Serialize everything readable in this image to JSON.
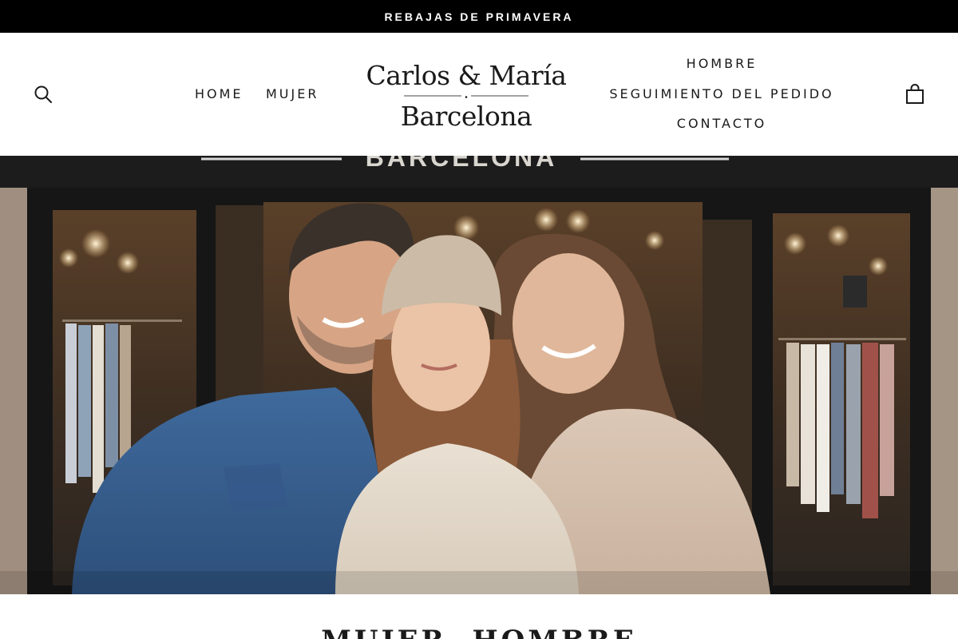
{
  "announcement": {
    "text": "REBAJAS DE PRIMAVERA"
  },
  "header": {
    "search_icon": "search-icon",
    "cart_icon": "shopping-bag-icon",
    "nav_left": [
      {
        "label": "HOME"
      },
      {
        "label": "MUJER"
      }
    ],
    "nav_right": [
      {
        "label": "HOMBRE"
      },
      {
        "label": "SEGUIMIENTO DEL PEDIDO"
      },
      {
        "label": "CONTACTO"
      }
    ],
    "logo": {
      "line1": "Carlos & María",
      "line2": "Barcelona"
    }
  },
  "hero": {
    "storefront_sign": "BARCELONA"
  },
  "section": {
    "title": "MUJER, HOMBRE"
  },
  "colors": {
    "announcement_bg": "#000000",
    "announcement_text": "#ffffff",
    "text": "#1a1a1a",
    "background": "#ffffff"
  }
}
